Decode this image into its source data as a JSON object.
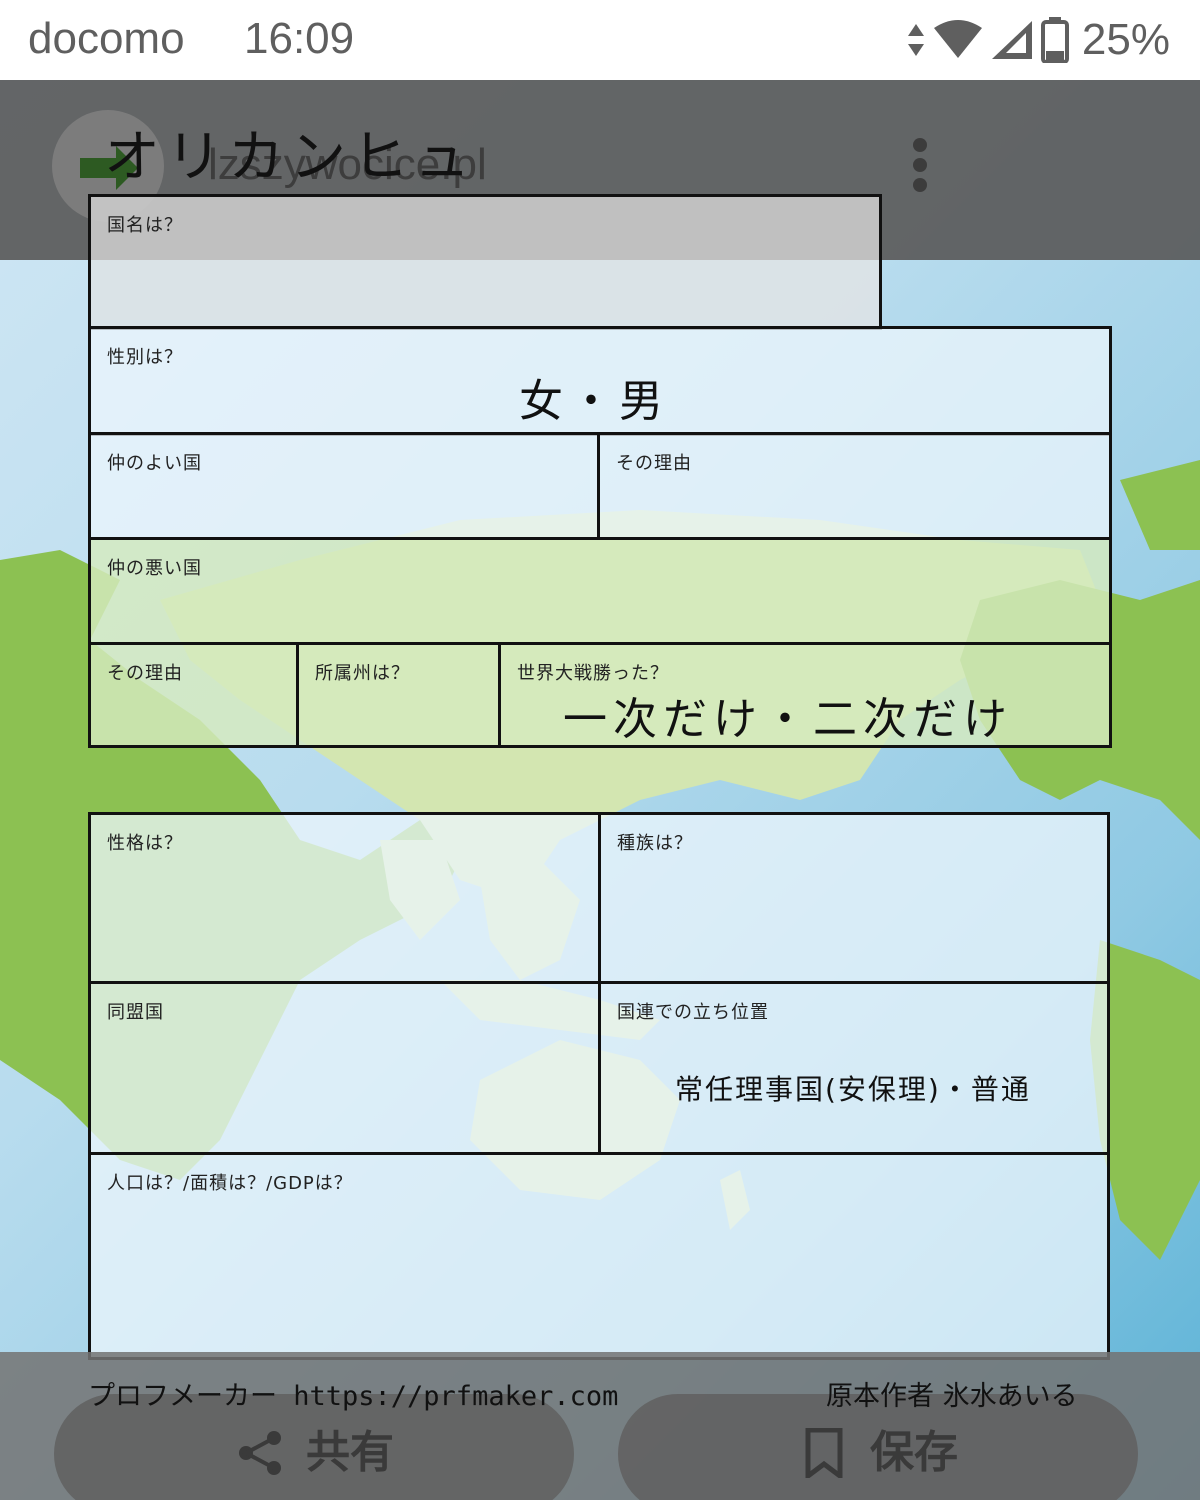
{
  "status_bar": {
    "carrier": "docomo",
    "time": "16:09",
    "battery": "25%"
  },
  "app_bar": {
    "site": "lzszywocice.pl"
  },
  "sheet": {
    "title": "オリカンヒュ",
    "country_name_label": "国名は？",
    "gender_label": "性別は？",
    "gender_value": "女・男",
    "friendly_country_label": "仲のよい国",
    "friendly_reason_label": "その理由",
    "unfriendly_country_label": "仲の悪い国",
    "unfriendly_reason_label": "その理由",
    "continent_label": "所属州は？",
    "world_war_label": "世界大戦勝った？",
    "world_war_value": "一次だけ・二次だけ",
    "personality_label": "性格は？",
    "race_label": "種族は？",
    "allies_label": "同盟国",
    "un_position_label": "国連での立ち位置",
    "un_position_value": "常任理事国(安保理)・普通",
    "population_label": "人口は？/面積は？/GDPは？"
  },
  "footer": {
    "left_credit": "プロフメーカー https://prfmaker.com",
    "right_credit": "原本作者 氷水あいる"
  },
  "actions": {
    "share_label": "共有",
    "save_label": "保存"
  }
}
